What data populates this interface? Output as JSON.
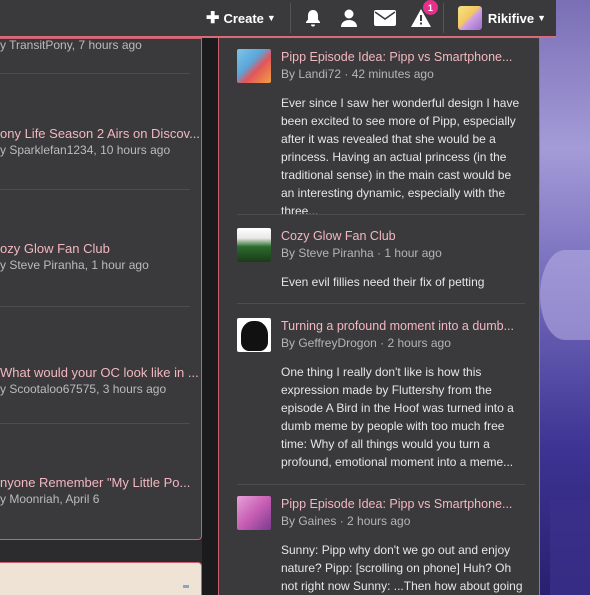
{
  "topbar": {
    "create_label": "Create",
    "username": "Rikifive",
    "alert_badge": "1",
    "accent": "#d86a7a"
  },
  "left_feed": [
    {
      "title": "",
      "meta": "y TransitPony, 7 hours ago"
    },
    {
      "title": "ony Life Season 2 Airs on Discov...",
      "meta": "y Sparklefan1234, 10 hours ago"
    },
    {
      "title": "ozy Glow Fan Club",
      "meta": "y Steve Piranha, 1 hour ago"
    },
    {
      "title": "What would your OC look like in ...",
      "meta": "y Scootaloo67575, 3 hours ago"
    },
    {
      "title": "nyone Remember \"My Little Po...",
      "meta": "y Moonriah, April 6"
    }
  ],
  "comments": [
    {
      "title": "Pipp Episode Idea: Pipp vs Smartphone...",
      "meta": "By Landi72 · 42 minutes ago",
      "body": "Ever since I saw her wonderful design I have been excited to see more of Pipp, especially after it was revealed that she would be a princess. Having an actual princess (in the traditional sense) in the main cast would be an interesting dynamic, especially with the three...",
      "avatar_icon": "pony-avatar-icon"
    },
    {
      "title": "Cozy Glow Fan Club",
      "meta": "By Steve Piranha · 1 hour ago",
      "body": "Even evil fillies need their fix of petting",
      "avatar_icon": "club-avatar-icon"
    },
    {
      "title": "Turning a profound moment into a dumb...",
      "meta": "By GeffreyDrogon · 2 hours ago",
      "body": "One thing I really don't like is how this expression made by Fluttershy from the episode A Bird in the Hoof was turned into a dumb meme by people with too much free time: Why of all things would you turn a profound, emotional moment into a meme...",
      "avatar_icon": "silhouette-avatar-icon"
    },
    {
      "title": "Pipp Episode Idea: Pipp vs Smartphone...",
      "meta": "By Gaines · 2 hours ago",
      "body": "Sunny: Pipp why don't we go out and enjoy nature? Pipp: [scrolling on phone] Huh? Oh not right now Sunny: ...Then how about going for a",
      "avatar_icon": "pony-avatar-icon"
    }
  ]
}
